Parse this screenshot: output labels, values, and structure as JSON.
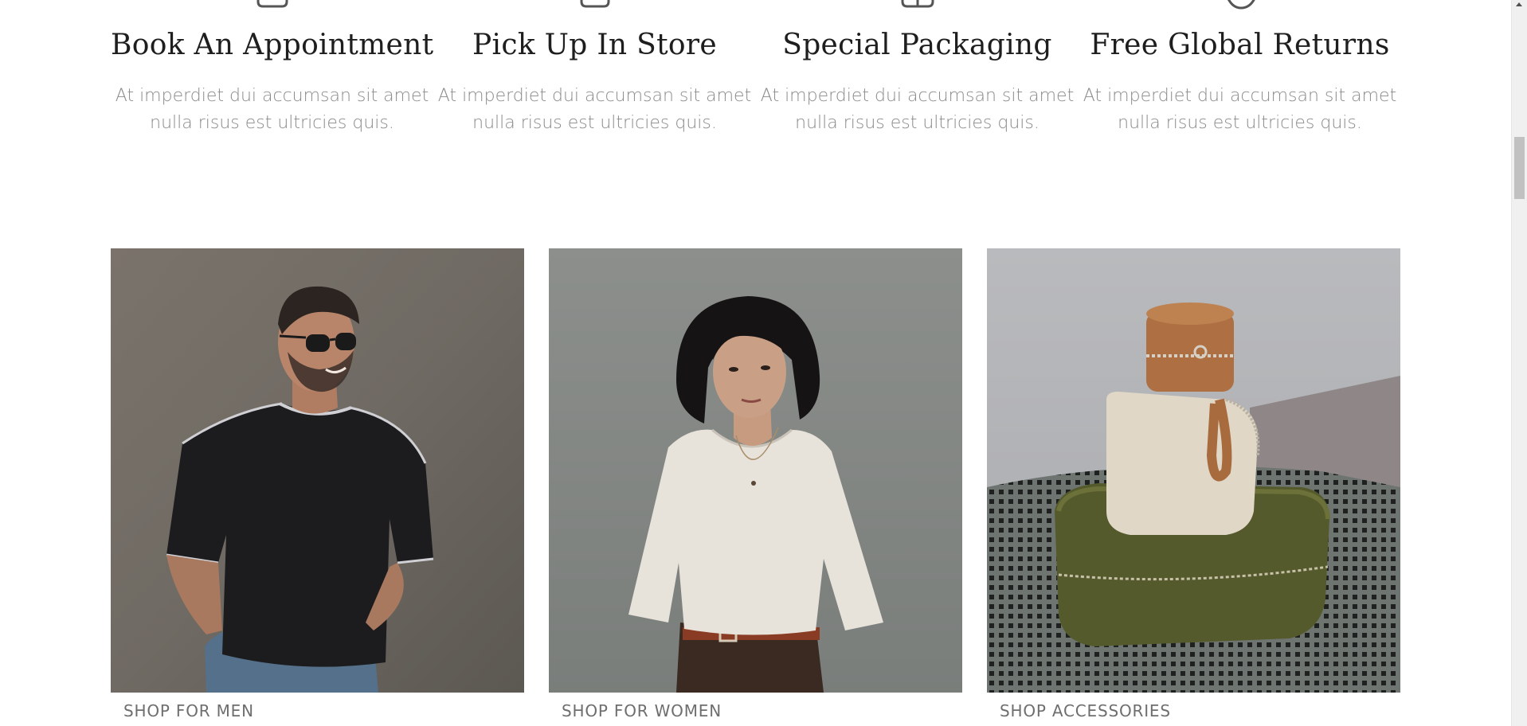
{
  "features": [
    {
      "icon": "calendar-icon",
      "title": "Book An Appointment",
      "desc_line1": "At imperdiet dui accumsan sit amet",
      "desc_line2": "nulla risus est ultricies quis."
    },
    {
      "icon": "store-bag-icon",
      "title": "Pick Up In Store",
      "desc_line1": "At imperdiet dui accumsan sit amet",
      "desc_line2": "nulla risus est ultricies quis."
    },
    {
      "icon": "gift-icon",
      "title": "Special Packaging",
      "desc_line1": "At imperdiet dui accumsan sit amet",
      "desc_line2": "nulla risus est ultricies quis."
    },
    {
      "icon": "return-arrow-icon",
      "title": "Free Global Returns",
      "desc_line1": "At imperdiet dui accumsan sit amet",
      "desc_line2": "nulla risus est ultricies quis."
    }
  ],
  "tiles": [
    {
      "label": "SHOP FOR MEN",
      "image": "man-black-tshirt-photo"
    },
    {
      "label": "SHOP FOR WOMEN",
      "image": "woman-white-top-photo"
    },
    {
      "label": "SHOP ACCESSORIES",
      "image": "leather-cases-photo"
    }
  ],
  "colors": {
    "title": "#1e1e1e",
    "body_text": "#8a8a8a",
    "label": "#6e6e6e",
    "background": "#ffffff"
  }
}
